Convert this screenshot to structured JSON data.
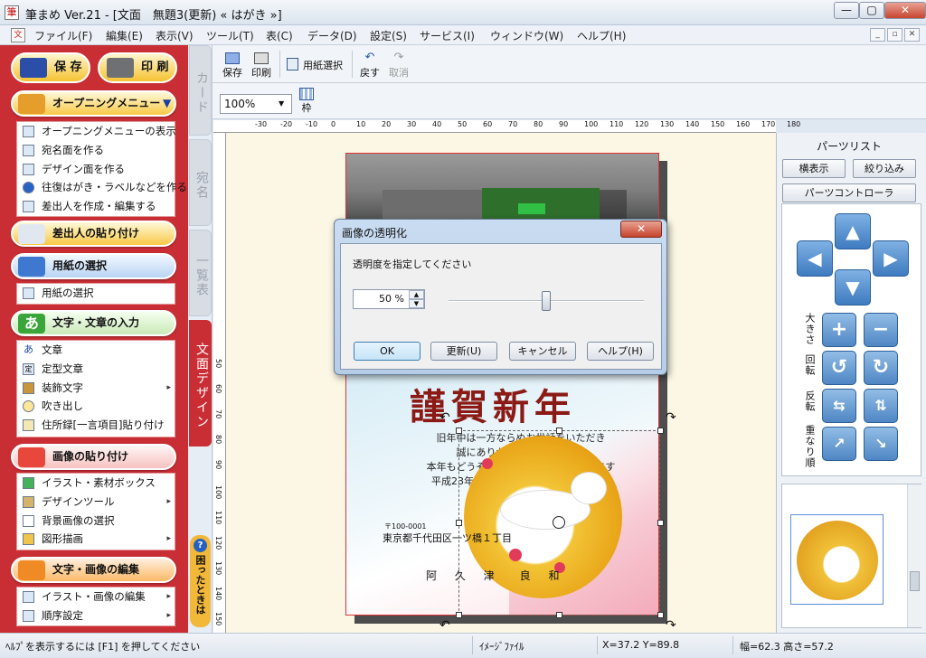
{
  "window": {
    "title": "筆まめ Ver.21 - [文面　無題3(更新) « はがき »]",
    "app_icon": "筆"
  },
  "menu": {
    "items": [
      "ファイル(F)",
      "編集(E)",
      "表示(V)",
      "ツール(T)",
      "表(C)",
      "データ(D)",
      "設定(S)",
      "サービス(I)",
      "ウィンドウ(W)",
      "ヘルプ(H)"
    ]
  },
  "sidebar": {
    "save": "保 存",
    "print": "印 刷",
    "opening": {
      "header": "オープニングメニュー",
      "items": [
        "オープニングメニューの表示",
        "宛名面を作る",
        "デザイン面を作る",
        "往復はがき・ラベルなどを作る",
        "差出人を作成・編集する"
      ]
    },
    "sender_paste": "差出人の貼り付け",
    "paper": {
      "header": "用紙の選択",
      "items": [
        "用紙の選択"
      ]
    },
    "text": {
      "header": "文字・文章の入力",
      "items": [
        "文章",
        "定型文章",
        "装飾文字",
        "吹き出し",
        "住所録[一言項目]貼り付け"
      ]
    },
    "image": {
      "header": "画像の貼り付け",
      "items": [
        "イラスト・素材ボックス",
        "デザインツール",
        "背景画像の選択",
        "図形描画"
      ]
    },
    "edit": {
      "header": "文字・画像の編集",
      "items": [
        "イラスト・画像の編集",
        "順序設定"
      ]
    }
  },
  "vtabs": {
    "card": "カード",
    "address": "宛名",
    "list": "一覧表",
    "design": "文面デザイン",
    "help": "困ったときは",
    "help_icon": "?"
  },
  "toolbar": {
    "save": "保存",
    "print": "印刷",
    "paper_select": "用紙選択",
    "undo": "戻す",
    "redo": "取消",
    "zoom": "100%",
    "frame": "枠"
  },
  "ruler": {
    "h_labels": [
      "-30",
      "-20",
      "-10",
      "0",
      "10",
      "20",
      "30",
      "40",
      "50",
      "60",
      "70",
      "80",
      "90",
      "100",
      "110",
      "120",
      "130",
      "140",
      "150",
      "160",
      "170",
      "180"
    ],
    "v_labels": [
      "50",
      "60",
      "70",
      "80",
      "90",
      "100",
      "110",
      "120",
      "130",
      "140",
      "150"
    ]
  },
  "card": {
    "greeting": "謹賀新年",
    "lines": [
      "旧年中は一方ならぬお世話をいただき",
      "誠にありがとうございました",
      "本年もどうぞよろしくお願い申し上げます",
      "平成23年　元旦"
    ],
    "zip": "〒100-0001",
    "address": "東京都千代田区一ツ橋１丁目",
    "name": "阿 久 津　良 和"
  },
  "dialog": {
    "title": "画像の透明化",
    "close": "✕",
    "prompt": "透明度を指定してください",
    "value": "50 %",
    "slider_fraction": 0.5,
    "buttons": [
      "OK",
      "更新(U)",
      "キャンセル",
      "ヘルプ(H)"
    ]
  },
  "parts": {
    "title": "パーツリスト",
    "horizontal": "横表示",
    "filter": "絞り込み",
    "controller": "パーツコントローラ",
    "labels": [
      "大きさ",
      "回転",
      "反転",
      "重なり順"
    ]
  },
  "status": {
    "help": "ﾍﾙﾌﾟを表示するには [F1] を押してください",
    "type": "ｲﾒｰｼﾞﾌｧｲﾙ",
    "coords": "X=37.2 Y=89.8",
    "size": "幅=62.3 高さ=57.2"
  }
}
